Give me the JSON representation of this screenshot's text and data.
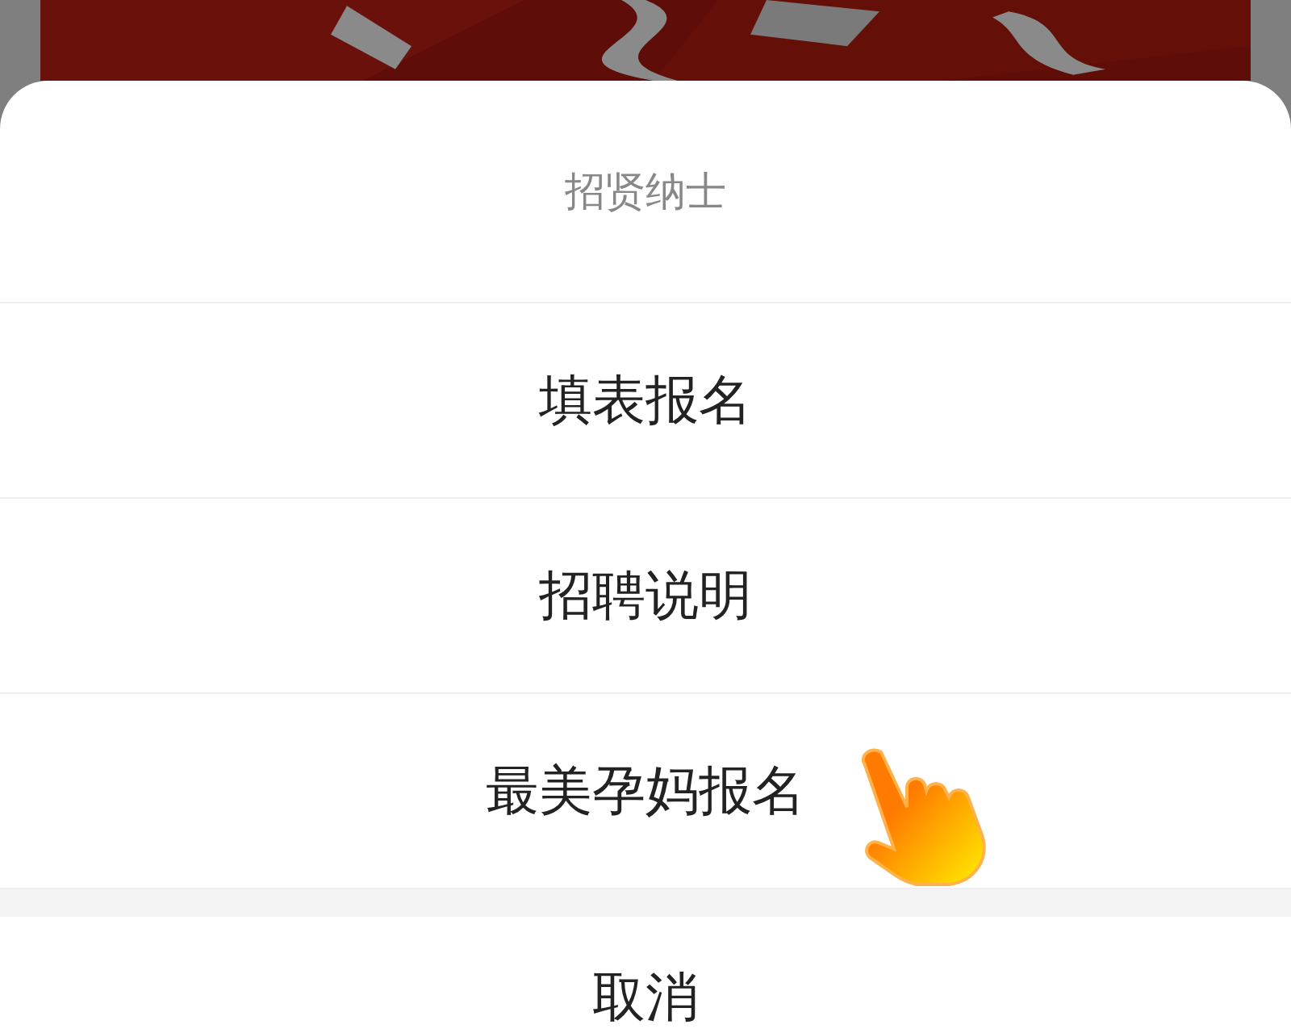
{
  "action_sheet": {
    "title": "招贤纳士",
    "options": [
      {
        "label": "填表报名",
        "pointer": false
      },
      {
        "label": "招聘说明",
        "pointer": false
      },
      {
        "label": "最美孕妈报名",
        "pointer": true
      }
    ],
    "cancel": "取消"
  }
}
